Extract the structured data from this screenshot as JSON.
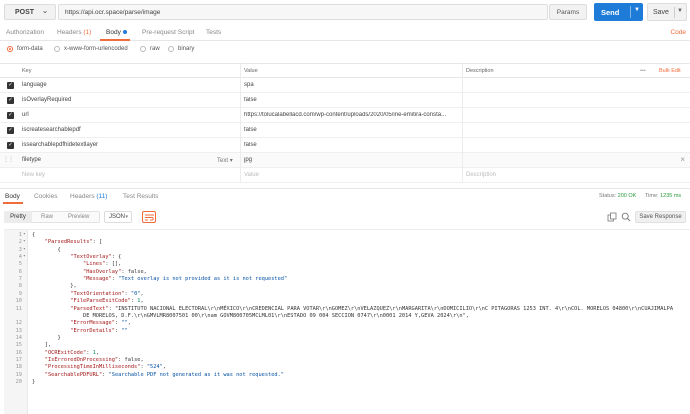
{
  "request": {
    "method": "POST",
    "url": "https://api.ocr.space/parse/image",
    "params_label": "Params",
    "send_label": "Send",
    "save_label": "Save"
  },
  "req_tabs": {
    "authorization": "Authorization",
    "headers": "Headers",
    "headers_count": "(1)",
    "body": "Body",
    "prerequest": "Pre-request Script",
    "tests": "Tests",
    "code": "Code"
  },
  "body_types": {
    "form_data": "form-data",
    "urlencoded": "x-www-form-urlencoded",
    "raw": "raw",
    "binary": "binary"
  },
  "kv_header": {
    "key": "Key",
    "value": "Value",
    "description": "Description",
    "more": "•••",
    "bulk_edit": "Bulk Edit"
  },
  "kv_rows": [
    {
      "key": "language",
      "value": "spa"
    },
    {
      "key": "isOverlayRequired",
      "value": "false"
    },
    {
      "key": "url",
      "value": "https://tolucalabellacd.com/wp-content/uploads/2020/05/ine-emitira-consta..."
    },
    {
      "key": "iscreatesearchablepdf",
      "value": "false"
    },
    {
      "key": "issearchablepdfhidetextlayer",
      "value": "false"
    }
  ],
  "file_row": {
    "key": "filetype",
    "type": "Text",
    "value": "jpg"
  },
  "new_row": {
    "key_placeholder": "New key",
    "value_placeholder": "Value",
    "desc_placeholder": "Description"
  },
  "resp_tabs": {
    "body": "Body",
    "cookies": "Cookies",
    "headers": "Headers",
    "headers_count": "(11)",
    "test_results": "Test Results"
  },
  "resp_meta": {
    "status_label": "Status:",
    "status_value": "200 OK",
    "time_label": "Time:",
    "time_value": "1235 ms"
  },
  "resp_toolbar": {
    "pretty": "Pretty",
    "raw": "Raw",
    "preview": "Preview",
    "format": "JSON",
    "save_response": "Save Response"
  },
  "code_lines": [
    "{",
    "    \"ParsedResults\": [",
    "        {",
    "            \"TextOverlay\": {",
    "                \"Lines\": [],",
    "                \"HasOverlay\": false,",
    "                \"Message\": \"Text overlay is not provided as it is not requested\"",
    "            },",
    "            \"TextOrientation\": \"0\",",
    "            \"FileParseExitCode\": 1,",
    "            \"ParsedText\": \"INSTITUTO NACIONAL ELECTORAL\\r\\nMÉXICO\\r\\nCREDENCIAL PARA VOTAR\\r\\nGOMEZ\\r\\nVELAZQUEZ\\r\\nMARGARITA\\r\\nDOMICILIO\\r\\nC PITAGORAS 1253 INT. 4\\r\\nCOL. MORELOS 04800\\r\\nCUAJIMALPA",
    "                DE MORELOS, D.F.\\r\\nGMVLMR8007501 00\\r\\nam GOVM800705MCLML01\\r\\nESTADO 09 004 SECCION 0747\\r\\n0001 2014 Y,GEVA 2024\\r\\n\",",
    "            \"ErrorMessage\": \"\",",
    "            \"ErrorDetails\": \"\"",
    "        }",
    "    ],",
    "    \"OCRExitCode\": 1,",
    "    \"IsErroredOnProcessing\": false,",
    "    \"ProcessingTimeInMilliseconds\": \"524\",",
    "    \"SearchablePDFURL\": \"Searchable PDF not generated as it was not requested.\"",
    "}"
  ],
  "line_numbers": [
    "1",
    "2",
    "3",
    "4",
    "5",
    "6",
    "7",
    "8",
    "9",
    "10",
    "11",
    "",
    "12",
    "13",
    "14",
    "15",
    "16",
    "17",
    "18",
    "19",
    "20"
  ],
  "colors": {
    "accent": "#f26b3a",
    "send": "#1f7bd8",
    "status_ok": "#2a9d3e"
  }
}
